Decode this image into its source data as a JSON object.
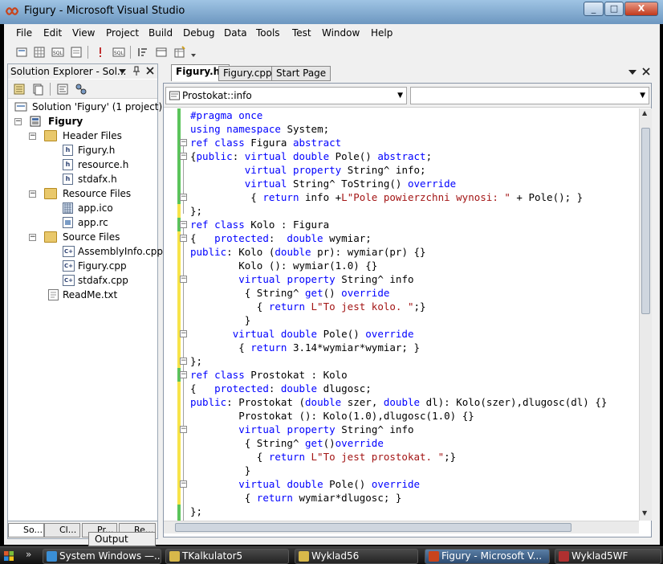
{
  "window": {
    "title": "Figury - Microsoft Visual Studio",
    "controls": [
      "_",
      "□",
      "X"
    ]
  },
  "menu": [
    "File",
    "Edit",
    "View",
    "Project",
    "Build",
    "Debug",
    "Data",
    "Tools",
    "Test",
    "Window",
    "Help"
  ],
  "solution_explorer": {
    "title": "Solution Explorer - Sol...",
    "solution": "Solution 'Figury' (1 project)",
    "project": "Figury",
    "header_files": "Header Files",
    "headers": [
      "Figury.h",
      "resource.h",
      "stdafx.h"
    ],
    "resource_files": "Resource Files",
    "resources": [
      "app.ico",
      "app.rc"
    ],
    "source_files": "Source Files",
    "sources": [
      "AssemblyInfo.cpp",
      "Figury.cpp",
      "stdafx.cpp"
    ],
    "readme": "ReadMe.txt",
    "bottom_tabs": [
      "So...",
      "Cl...",
      "Pr...",
      "Re..."
    ]
  },
  "doc_tabs": [
    "Figury.h*",
    "Figury.cpp",
    "Start Page"
  ],
  "nav": {
    "left": "Prostokat::info",
    "right": ""
  },
  "code": [
    "#pragma once",
    "using namespace System;",
    "ref class Figura abstract",
    "{public: virtual double Pole() abstract;",
    "         virtual property String^ info;",
    "         virtual String^ ToString() override",
    "          { return info +L\"Pole powierzchni wynosi: \" + Pole(); }",
    "};",
    "ref class Kolo : Figura",
    "{   protected:  double wymiar;",
    "public: Kolo (double pr): wymiar(pr) {}",
    "        Kolo (): wymiar(1.0) {}",
    "        virtual property String^ info",
    "         { String^ get() override",
    "           { return L\"To jest kolo. \";}",
    "         }",
    "       virtual double Pole() override",
    "        { return 3.14*wymiar*wymiar; }",
    "};",
    "ref class Prostokat : Kolo",
    "{   protected: double dlugosc;",
    "public: Prostokat (double szer, double dl): Kolo(szer),dlugosc(dl) {}",
    "        Prostokat (): Kolo(1.0),dlugosc(1.0) {}",
    "        virtual property String^ info",
    "         { String^ get()override",
    "           { return L\"To jest prostokat. \";}",
    "         }",
    "        virtual double Pole() override",
    "         { return wymiar*dlugosc; }",
    "};"
  ],
  "output_tab": "Output",
  "taskbar": [
    "System Windows —...",
    "TKalkulator5",
    "Wyklad56",
    "Figury - Microsoft V...",
    "Wyklad5WF"
  ],
  "colors": {
    "keyword": "#0000ff",
    "string": "#a31515",
    "changed_line": "#f7e34a",
    "saved_line": "#5bc45b"
  }
}
